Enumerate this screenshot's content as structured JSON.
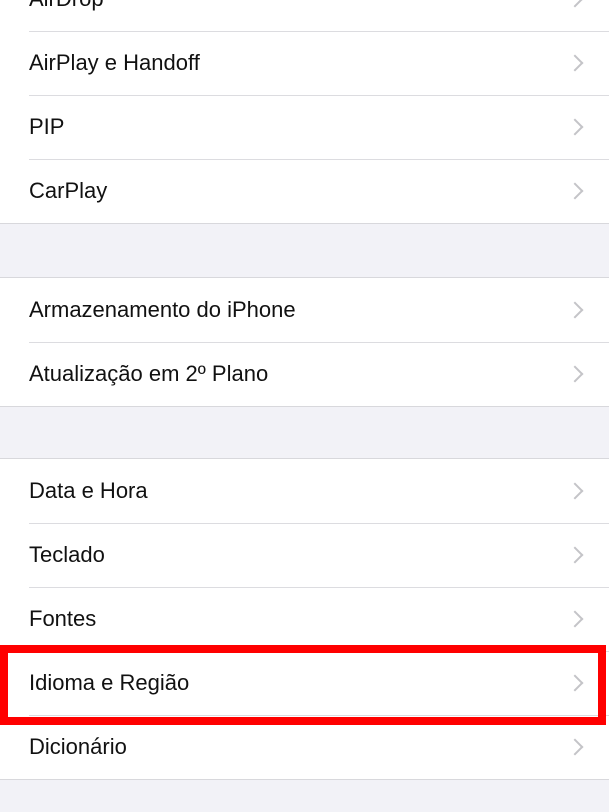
{
  "groups": [
    {
      "items": [
        {
          "label": "AirDrop"
        },
        {
          "label": "AirPlay e Handoff"
        },
        {
          "label": "PIP"
        },
        {
          "label": "CarPlay"
        }
      ]
    },
    {
      "items": [
        {
          "label": "Armazenamento do iPhone"
        },
        {
          "label": "Atualização em 2º Plano"
        }
      ]
    },
    {
      "items": [
        {
          "label": "Data e Hora"
        },
        {
          "label": "Teclado"
        },
        {
          "label": "Fontes"
        },
        {
          "label": "Idioma e Região"
        },
        {
          "label": "Dicionário"
        }
      ]
    }
  ],
  "highlight": {
    "target": "Idioma e Região",
    "color": "#ff0000"
  },
  "colors": {
    "background": "#f2f2f7",
    "cell": "#ffffff",
    "chevron": "#c4c4c8"
  }
}
